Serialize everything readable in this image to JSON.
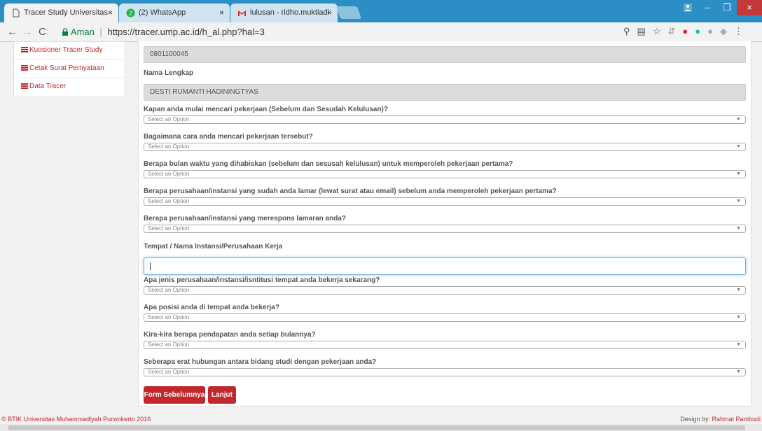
{
  "browser": {
    "tabs": [
      {
        "label": "Tracer Study Universitas",
        "close": "×"
      },
      {
        "label": "(2) WhatsApp",
        "close": "×"
      },
      {
        "label": "lulusan - ridho.muktiadi",
        "close": "×"
      }
    ],
    "address": {
      "secure_label": "Aman",
      "url": "https://tracer.ump.ac.id/h_al.php?hal=3"
    },
    "window_controls": {
      "minimize": "–",
      "maximize": "❐",
      "close": "×"
    }
  },
  "sidebar": {
    "items": [
      {
        "label": "Kuosioner Tracer Study"
      },
      {
        "label": "Cetak Surat Pernyataan"
      },
      {
        "label": "Data Tracer"
      }
    ]
  },
  "form": {
    "nim_value": "0801100045",
    "nama_label": "Nama Lengkap",
    "nama_value": "DESTI RUMANTI HADININGTYAS",
    "select_placeholder": "Select an Option",
    "questions": [
      "Kapan anda mulai mencari pekerjaan (Sebelum dan Sesudah Kelulusan)?",
      "Bagaimana cara anda mencari pekerjaan tersebut?",
      "Berapa bulan waktu yang dihabiskan (sebelum dan sesusah kelulusan) untuk memperoleh pekerjaan pertama?",
      "Berapa perusahaan/instansi yang sudah anda lamar (lewat surat atau email) sebelum anda memperoleh pekerjaan pertama?",
      "Berapa perusahaan/instansi yang merespons lamaran anda?"
    ],
    "tempat_label": "Tempat / Nama Instansi/Perusahaan Kerja",
    "tempat_value": "",
    "questions2": [
      "Apa jenis perusahaan/instansi/isntitusi tempat anda bekerja sekarang?",
      "Apa posisi anda di tempat anda bekerja?",
      "Kira-kira berapa pendapatan anda setiap bulannya?",
      "Seberapa erat hubungan antara bidang studi dengan pekerjaan anda?"
    ],
    "btn_prev": "Form Sebelumnya",
    "btn_next": "Lanjut"
  },
  "footer": {
    "left": "© BTIK Universitas Muhammadiyah Purwokerto 2016",
    "right_prefix": "Design by: ",
    "right_name": "Rahmat Pambudi"
  },
  "colors": {
    "brand": "#c1272d",
    "chrome": "#2b8fc6"
  }
}
